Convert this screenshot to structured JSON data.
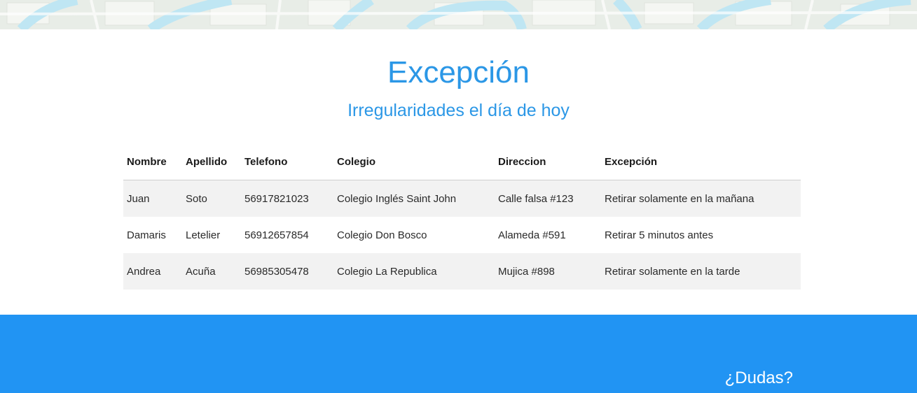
{
  "header": {
    "title": "Excepción",
    "subtitle": "Irregularidades el día de hoy"
  },
  "table": {
    "columns": [
      "Nombre",
      "Apellido",
      "Telefono",
      "Colegio",
      "Direccion",
      "Excepción"
    ],
    "rows": [
      [
        "Juan",
        "Soto",
        "56917821023",
        "Colegio Inglés Saint John",
        "Calle falsa #123",
        "Retirar solamente en la mañana"
      ],
      [
        "Damaris",
        "Letelier",
        "56912657854",
        "Colegio Don Bosco",
        "Alameda #591",
        "Retirar 5 minutos antes"
      ],
      [
        "Andrea",
        "Acuña",
        "56985305478",
        "Colegio La Republica",
        "Mujica #898",
        "Retirar solamente en la tarde"
      ]
    ]
  },
  "footer": {
    "heading": "¿Dudas?"
  },
  "colors": {
    "accent": "#2b97e6",
    "footer_bg": "#2194f3",
    "row_stripe": "#f2f2f2"
  }
}
